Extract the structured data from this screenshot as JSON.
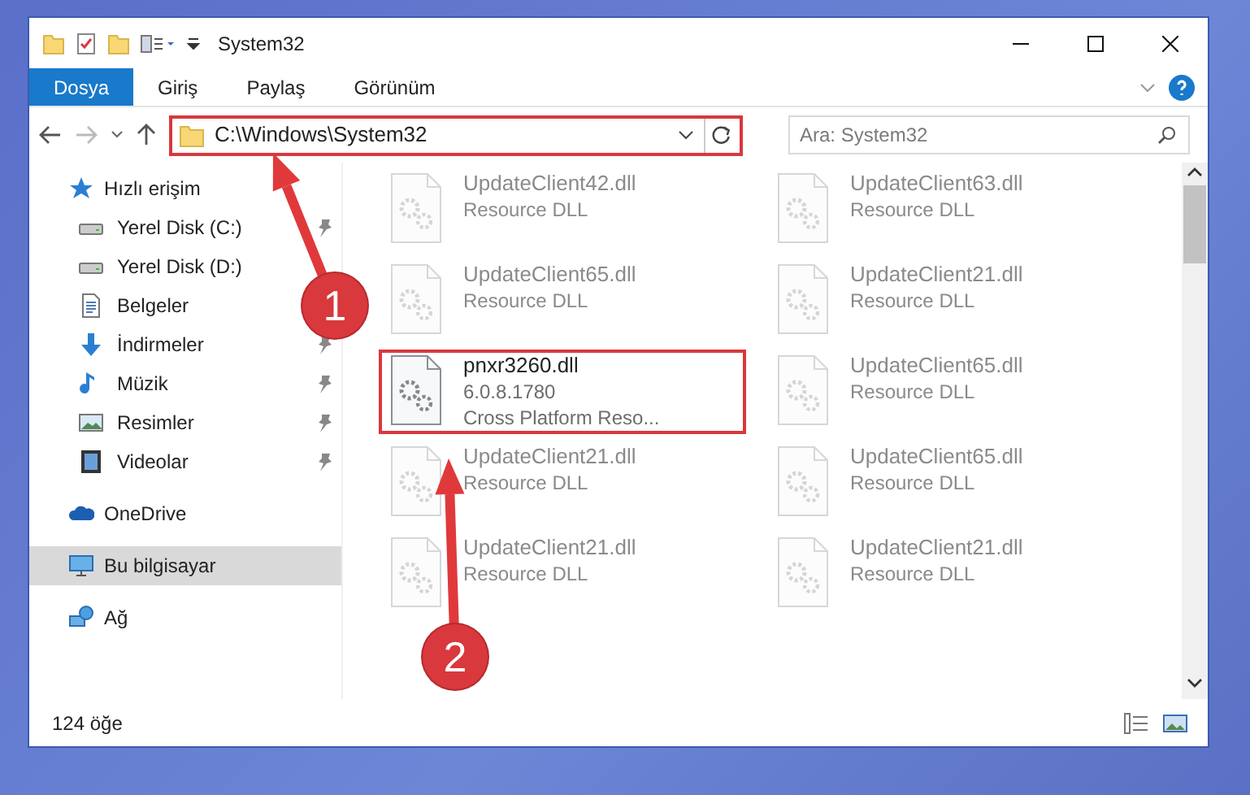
{
  "window": {
    "title": "System32"
  },
  "ribbon_tabs": [
    {
      "label": "Dosya",
      "selected": true
    },
    {
      "label": "Giriş",
      "selected": false
    },
    {
      "label": "Paylaş",
      "selected": false
    },
    {
      "label": "Görünüm",
      "selected": false
    }
  ],
  "address_bar": {
    "path": "C:\\Windows\\System32",
    "highlighted": true
  },
  "search": {
    "placeholder": "Ara: System32"
  },
  "sidebar": {
    "items": [
      {
        "label": "Hızlı erişim",
        "kind": "star",
        "pinned": false,
        "selected": false,
        "children": [
          {
            "label": "Yerel Disk (C:)",
            "kind": "drive",
            "pinned": true,
            "selected": false
          },
          {
            "label": "Yerel Disk (D:)",
            "kind": "drive",
            "pinned": false,
            "selected": false
          },
          {
            "label": "Belgeler",
            "kind": "doc",
            "pinned": false,
            "selected": false
          },
          {
            "label": "İndirmeler",
            "kind": "download",
            "pinned": true,
            "selected": false
          },
          {
            "label": "Müzik",
            "kind": "music",
            "pinned": true,
            "selected": false
          },
          {
            "label": "Resimler",
            "kind": "image",
            "pinned": true,
            "selected": false
          },
          {
            "label": "Videolar",
            "kind": "video",
            "pinned": true,
            "selected": false
          }
        ]
      },
      {
        "label": "OneDrive",
        "kind": "cloud",
        "pinned": false,
        "selected": false
      },
      {
        "label": "Bu bilgisayar",
        "kind": "pc",
        "pinned": false,
        "selected": true
      },
      {
        "label": "Ağ",
        "kind": "network",
        "pinned": false,
        "selected": false
      }
    ]
  },
  "files": [
    {
      "name": "UpdateClient42.dll",
      "details": [
        "Resource DLL"
      ],
      "faded": true,
      "highlighted": false
    },
    {
      "name": "UpdateClient63.dll",
      "details": [
        "Resource DLL"
      ],
      "faded": true,
      "highlighted": false
    },
    {
      "name": "UpdateClient65.dll",
      "details": [
        "Resource DLL"
      ],
      "faded": true,
      "highlighted": false
    },
    {
      "name": "UpdateClient21.dll",
      "details": [
        "Resource DLL"
      ],
      "faded": true,
      "highlighted": false
    },
    {
      "name": "pnxr3260.dll",
      "details": [
        "6.0.8.1780",
        "Cross Platform Reso..."
      ],
      "faded": false,
      "highlighted": true
    },
    {
      "name": "UpdateClient65.dll",
      "details": [
        "Resource DLL"
      ],
      "faded": true,
      "highlighted": false
    },
    {
      "name": "UpdateClient21.dll",
      "details": [
        "Resource DLL"
      ],
      "faded": true,
      "highlighted": false
    },
    {
      "name": "UpdateClient65.dll",
      "details": [
        "Resource DLL"
      ],
      "faded": true,
      "highlighted": false
    },
    {
      "name": "UpdateClient21.dll",
      "details": [
        "Resource DLL"
      ],
      "faded": true,
      "highlighted": false
    },
    {
      "name": "UpdateClient21.dll",
      "details": [
        "Resource DLL"
      ],
      "faded": true,
      "highlighted": false
    }
  ],
  "status_bar": {
    "item_count": "124 öğe"
  },
  "annotations": [
    {
      "label": "1"
    },
    {
      "label": "2"
    }
  ]
}
